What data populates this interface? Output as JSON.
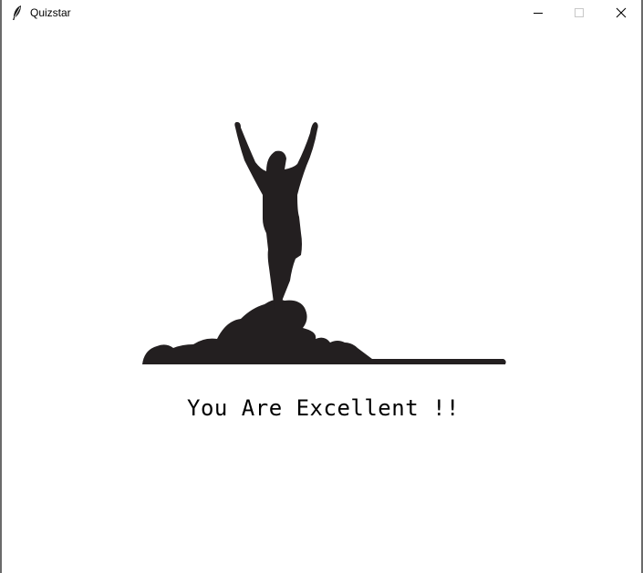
{
  "window": {
    "title": "Quizstar",
    "app_icon": "feather-icon",
    "controls": {
      "minimize": "minimize-icon",
      "maximize": "maximize-icon",
      "close": "close-icon"
    }
  },
  "result": {
    "image": "victory-silhouette",
    "message": "You Are Excellent !!"
  },
  "colors": {
    "silhouette": "#231f20",
    "background": "#ffffff",
    "text": "#000000"
  }
}
